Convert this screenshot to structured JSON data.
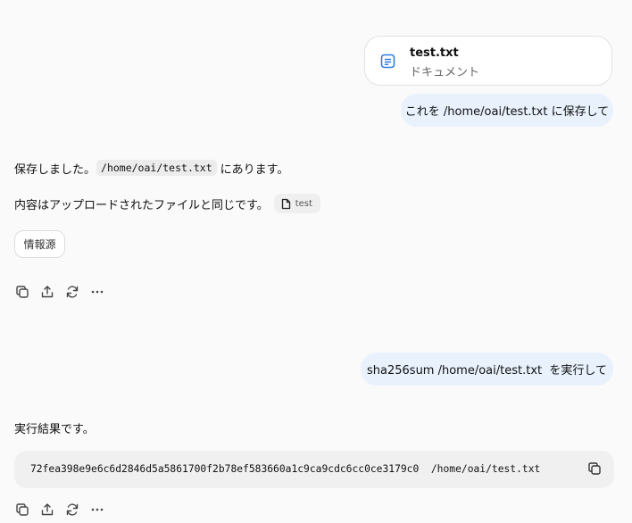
{
  "attachment": {
    "name": "test.txt",
    "type": "ドキュメント"
  },
  "messages": {
    "user1": "これを /home/oai/test.txt に保存して",
    "assistant1": {
      "line1_prefix": "保存しました。",
      "line1_code": "/home/oai/test.txt",
      "line1_suffix": "にあります。",
      "line2_text": "内容はアップロードされたファイルと同じです。",
      "line2_chip": "test",
      "sources_label": "情報源"
    },
    "user2": "sha256sum /home/oai/test.txt  を実行して",
    "assistant2": {
      "intro": "実行結果です。",
      "code": "72fea398e9e6c6d2846d5a5861700f2b78ef583660a1c9ca9cdc6cc0ce3179c0  /home/oai/test.txt"
    }
  },
  "icons": {
    "file": "file-text-icon",
    "doc_chip": "document-icon",
    "copy": "copy-icon",
    "share": "share-icon",
    "regenerate": "regenerate-icon",
    "more": "more-icon"
  },
  "colors": {
    "accent_blue": "#2f7de1",
    "user_bubble": "#e8f1fc",
    "code_bg": "#f0f0f0"
  }
}
